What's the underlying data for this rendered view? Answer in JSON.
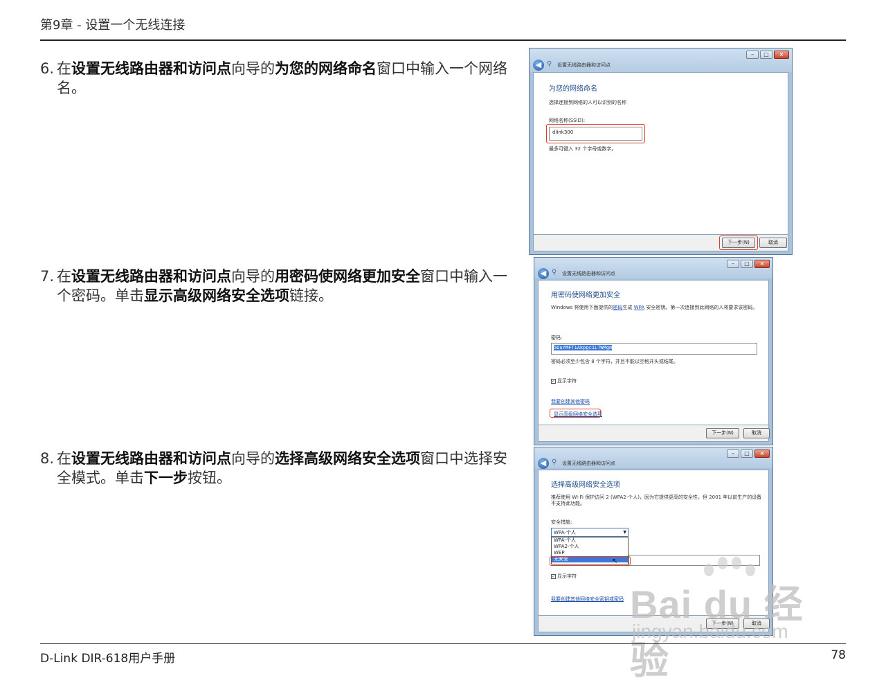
{
  "header": {
    "title": "第9章 - 设置一个无线连接"
  },
  "footer": {
    "manual": "D-Link DIR-618用户手册",
    "page": "78"
  },
  "steps": [
    {
      "num": "6.",
      "parts": [
        "在",
        "设置无线路由器和访问点",
        "向导的",
        "为您的网络命名",
        "窗口中输入一个网络名。"
      ]
    },
    {
      "num": "7.",
      "parts": [
        "在",
        "设置无线路由器和访问点",
        "向导的",
        "用密码使网络更加安全",
        "窗口中输入一个密码。单击",
        "显示高级网络安全选项",
        "链接。"
      ]
    },
    {
      "num": "8.",
      "parts": [
        "在",
        "设置无线路由器和访问点",
        "向导的",
        "选择高级网络安全选项",
        "窗口中选择安全模式。单击",
        "下一步",
        "按钮。"
      ]
    }
  ],
  "dialogs": {
    "window_title": "设置无线路由器和访问点",
    "d1": {
      "heading": "为您的网络命名",
      "desc": "选择连接到网络的人可以识别的名称",
      "field_label": "网络名称(SSID):",
      "field_value": "dlink300",
      "hint": "最多可键入 32 个字母或数字。",
      "next": "下一步(N)",
      "cancel": "取消"
    },
    "d2": {
      "heading": "用密码使网络更加安全",
      "desc": "Windows 将使用下面提供的密码生成 WPA 安全密钥。第一次连接到此网络的人将要求该密码。",
      "field_label": "密码:",
      "field_value": "5DuYMFT1Akpgc1LTWMgm",
      "hint": "密码必须至少包含 8 个字符，并且不能以空格开头或结尾。",
      "show_chars": "显示字符",
      "link1": "我要创建其他密码",
      "link2": "显示高级网络安全选项",
      "next": "下一步(N)",
      "cancel": "取消"
    },
    "d3": {
      "heading": "选择高级网络安全选项",
      "desc_line1": "推荐使用 Wi-Fi 保护访问 2 (WPA2-个人)，因为它提供更高的安全性，但 2001 年以前生产的设备",
      "desc_line2": "不支持此功能。",
      "field_label": "安全措施:",
      "selected": "WPA-个人",
      "options": [
        "WPA-个人",
        "WPA2-个人",
        "WEP",
        "无安全"
      ],
      "show_chars": "显示字符",
      "link1": "我要创建其他网络安全密钥或密码",
      "next": "下一步(N)",
      "cancel": "取消"
    }
  },
  "watermark": {
    "line1": "Bai du 经验",
    "line2": "jingyan.baidu.com"
  }
}
